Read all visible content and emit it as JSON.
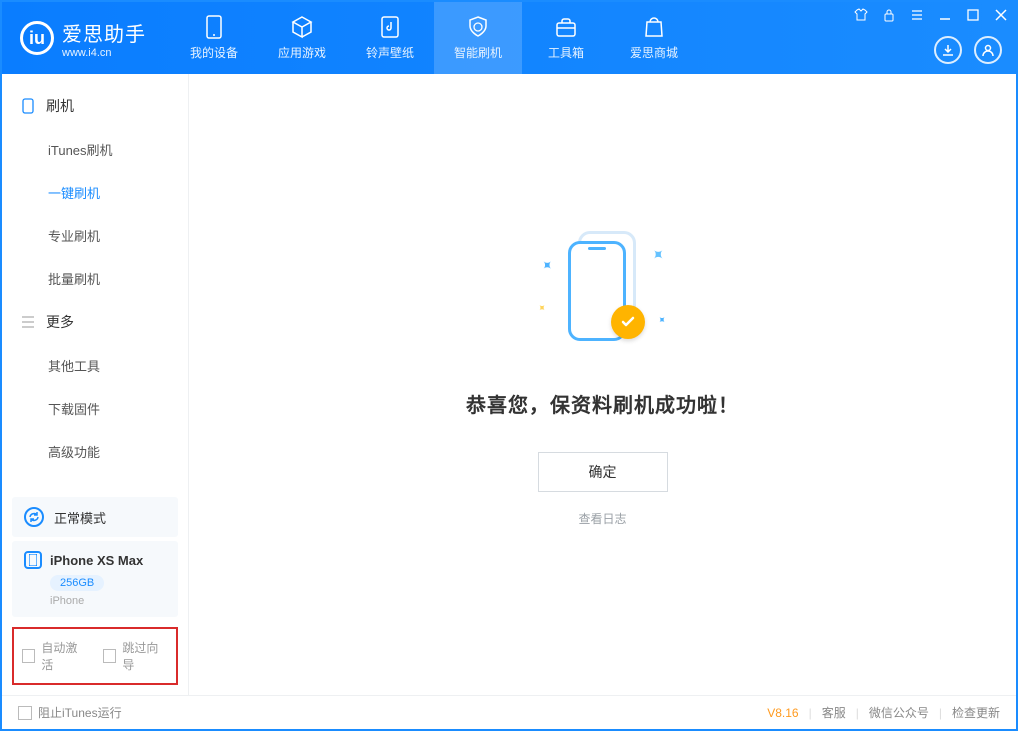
{
  "app": {
    "name_cn": "爱思助手",
    "url": "www.i4.cn"
  },
  "nav": {
    "items": [
      {
        "label": "我的设备"
      },
      {
        "label": "应用游戏"
      },
      {
        "label": "铃声壁纸"
      },
      {
        "label": "智能刷机"
      },
      {
        "label": "工具箱"
      },
      {
        "label": "爱思商城"
      }
    ],
    "active_index": 3
  },
  "sidebar": {
    "group1_title": "刷机",
    "group1_items": [
      {
        "label": "iTunes刷机"
      },
      {
        "label": "一键刷机"
      },
      {
        "label": "专业刷机"
      },
      {
        "label": "批量刷机"
      }
    ],
    "group1_active_index": 1,
    "group2_title": "更多",
    "group2_items": [
      {
        "label": "其他工具"
      },
      {
        "label": "下载固件"
      },
      {
        "label": "高级功能"
      }
    ],
    "mode_label": "正常模式",
    "device": {
      "name": "iPhone XS Max",
      "capacity": "256GB",
      "sub": "iPhone"
    },
    "options": {
      "auto_activate": "自动激活",
      "skip_wizard": "跳过向导"
    }
  },
  "main": {
    "success_text": "恭喜您，保资料刷机成功啦！",
    "ok_button": "确定",
    "view_log": "查看日志"
  },
  "footer": {
    "block_itunes": "阻止iTunes运行",
    "version": "V8.16",
    "links": {
      "support": "客服",
      "wechat": "微信公众号",
      "update": "检查更新"
    }
  }
}
